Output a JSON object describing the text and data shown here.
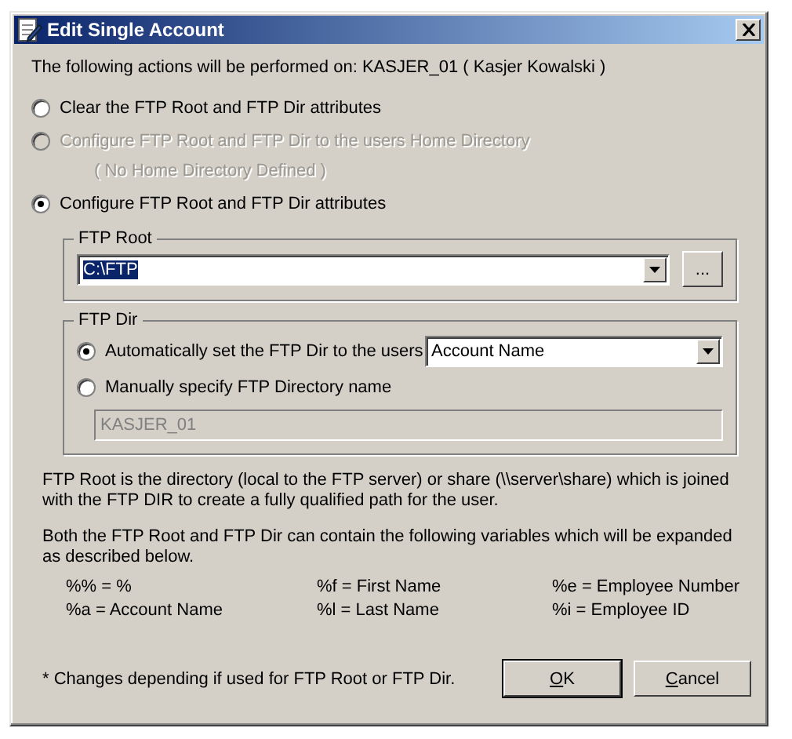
{
  "window": {
    "title": "Edit Single Account"
  },
  "intro": "The following actions will be performed on:  KASJER_01 ( Kasjer Kowalski )",
  "options": [
    {
      "label": "Clear the FTP Root and FTP Dir attributes",
      "selected": false,
      "disabled": false
    },
    {
      "label": "Configure FTP Root and FTP Dir to the users Home Directory",
      "selected": false,
      "disabled": true,
      "note": "( No Home Directory Defined )"
    },
    {
      "label": "Configure FTP Root and FTP Dir attributes",
      "selected": true,
      "disabled": false
    }
  ],
  "ftp_root": {
    "title": "FTP Root",
    "value": "C:\\FTP",
    "highlighted": true,
    "browse": "..."
  },
  "ftp_dir": {
    "title": "FTP Dir",
    "options": [
      {
        "label": "Automatically set the FTP Dir to the users",
        "selected": true,
        "kind": "auto"
      },
      {
        "label": "Manually specify FTP Directory name",
        "selected": false,
        "kind": "manual"
      }
    ],
    "dir_type": "Account Name",
    "manual_value": "KASJER_01",
    "manual_disabled": true
  },
  "description": [
    "FTP Root is the directory (local to the FTP server) or share (\\\\server\\share) which is joined with the FTP DIR to create a fully qualified path for the user.",
    "Both the FTP Root and FTP Dir can contain the following variables which will be expanded as described below."
  ],
  "variables": [
    [
      "%% = %",
      "%f = First Name",
      "%e = Employee Number"
    ],
    [
      "%a = Account Name",
      "%l = Last Name",
      "%i  = Employee ID"
    ]
  ],
  "footnote": "* Changes depending if used for FTP Root or FTP Dir.",
  "buttons": [
    {
      "label": "OK",
      "default": true
    },
    {
      "label": "Cancel",
      "default": false
    }
  ]
}
